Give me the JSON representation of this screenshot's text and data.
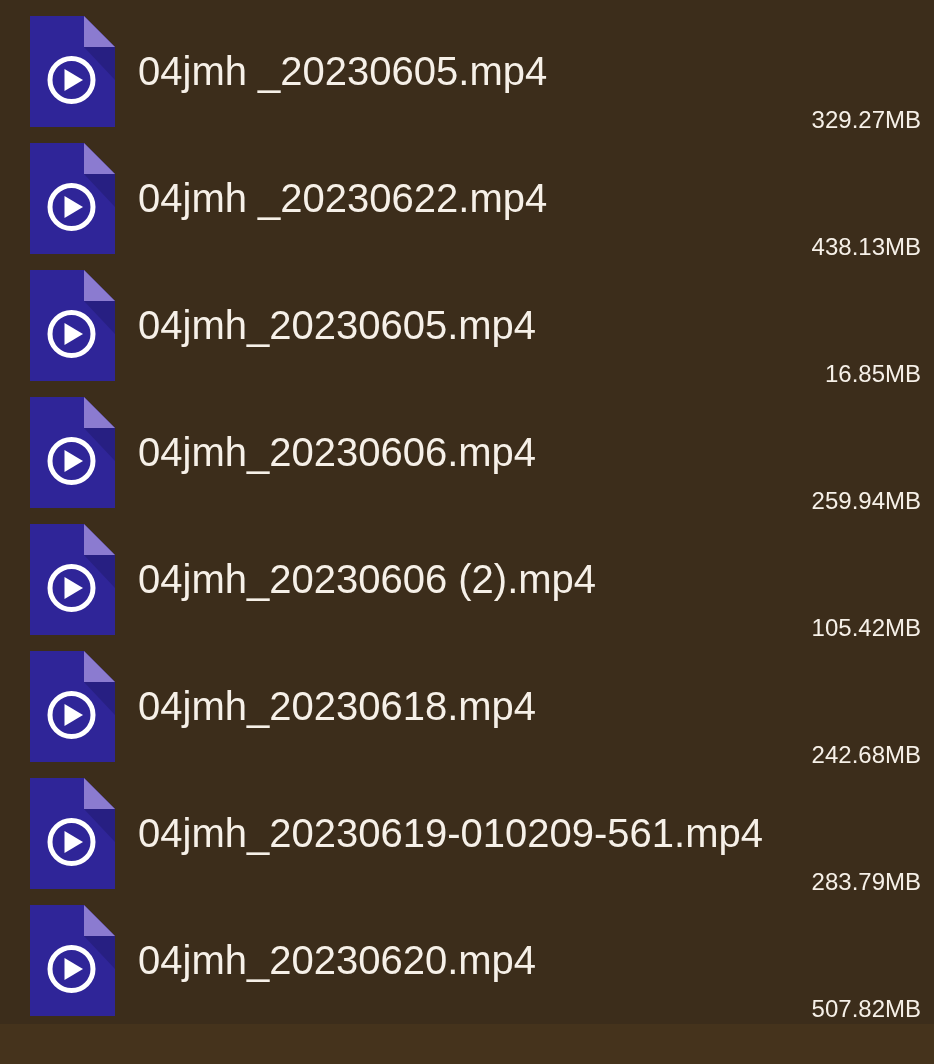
{
  "files": [
    {
      "name": "04jmh _20230605.mp4",
      "size": "329.27MB"
    },
    {
      "name": "04jmh _20230622.mp4",
      "size": "438.13MB"
    },
    {
      "name": "04jmh_20230605.mp4",
      "size": "16.85MB"
    },
    {
      "name": "04jmh_20230606.mp4",
      "size": "259.94MB"
    },
    {
      "name": "04jmh_20230606 (2).mp4",
      "size": "105.42MB"
    },
    {
      "name": "04jmh_20230618.mp4",
      "size": "242.68MB"
    },
    {
      "name": "04jmh_20230619-010209-561.mp4",
      "size": "283.79MB"
    },
    {
      "name": "04jmh_20230620.mp4",
      "size": "507.82MB"
    }
  ]
}
